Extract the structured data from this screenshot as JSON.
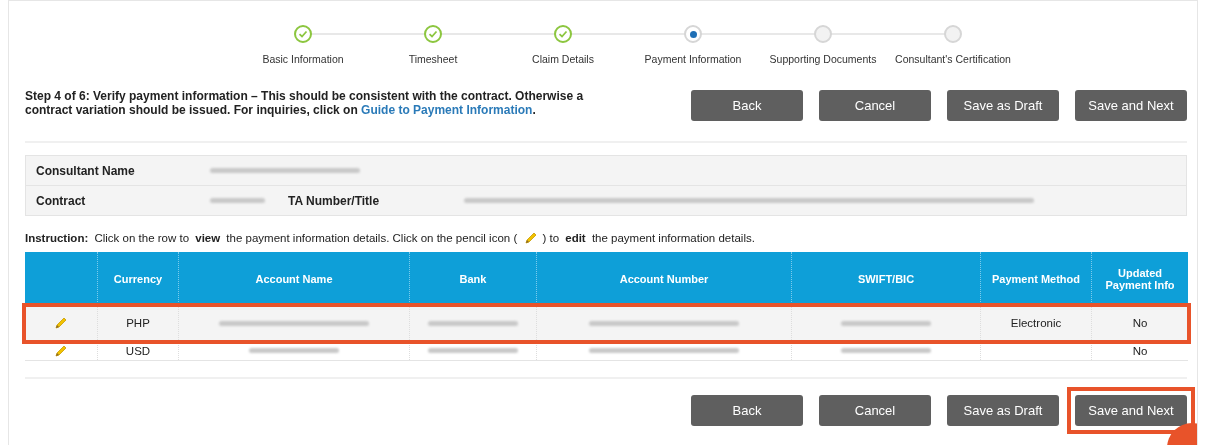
{
  "steps": [
    {
      "label": "Basic Information",
      "completed": true,
      "current": false
    },
    {
      "label": "Timesheet",
      "completed": true,
      "current": false
    },
    {
      "label": "Claim Details",
      "completed": true,
      "current": false
    },
    {
      "label": "Payment Information",
      "completed": false,
      "current": true
    },
    {
      "label": "Supporting Documents",
      "completed": false,
      "current": false
    },
    {
      "label": "Consultant's Certification",
      "completed": false,
      "current": false
    }
  ],
  "intro": {
    "text": "Step 4 of 6: Verify payment information – This should be consistent with the contract. Otherwise a contract variation should be issued. For inquiries, click on ",
    "link": "Guide to Payment Information",
    "end": "."
  },
  "top_buttons": [
    {
      "label": "Back"
    },
    {
      "label": "Cancel"
    },
    {
      "label": "Save as Draft"
    },
    {
      "label": "Save and Next"
    }
  ],
  "consultant": {
    "name_label": "Consultant Name",
    "contract_label": "Contract",
    "ta_label": "TA Number/Title"
  },
  "instruction": {
    "text": "**Instruction:** Click on the row to **view** the payment information details. Click on the pencil icon (",
    "text_end": ") to **edit** the payment information details."
  },
  "table": {
    "columns": [
      "Currency",
      "Account Name",
      "Bank",
      "Account Number",
      "SWIFT/BIC",
      "Payment Method",
      "Updated Payment Info"
    ],
    "rows": [
      {
        "currency": "PHP",
        "payment_method": "Electronic",
        "updated": "No",
        "highlighted": true
      },
      {
        "currency": "USD",
        "updated": "No",
        "highlighted": false
      }
    ]
  },
  "bottom_buttons": [
    {
      "label": "Back",
      "highlighted": false
    },
    {
      "label": "Cancel",
      "highlighted": false
    },
    {
      "label": "Save as Draft",
      "highlighted": false
    },
    {
      "label": "Save and Next",
      "highlighted": true
    }
  ]
}
